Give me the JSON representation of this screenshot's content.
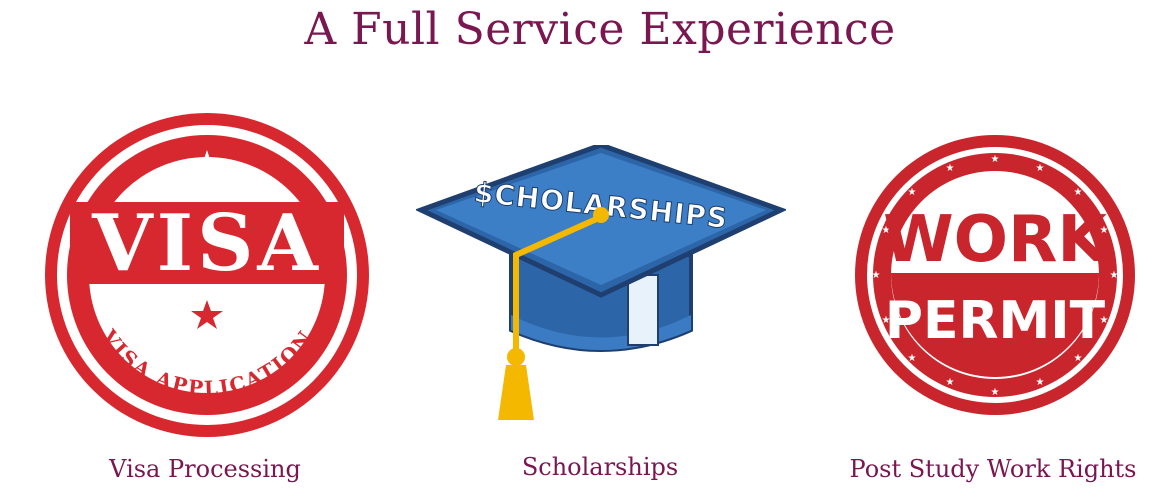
{
  "page": {
    "title": "A Full Service Experience"
  },
  "services": [
    {
      "caption": "Visa Processing",
      "badge": {
        "main_text": "VISA",
        "ring_text": "VISA APPLICATION",
        "color": "#d8282f"
      }
    },
    {
      "caption": "Scholarships",
      "cap": {
        "band_text": "$CHOLARSHIPS",
        "cap_color": "#2c66a8",
        "tassel_color": "#f5b800"
      }
    },
    {
      "caption": "Post Study Work Rights",
      "badge": {
        "line1": "WORK",
        "line2": "PERMIT",
        "color": "#c9252c"
      }
    }
  ],
  "colors": {
    "title": "#7a1650",
    "caption": "#7a1650"
  }
}
